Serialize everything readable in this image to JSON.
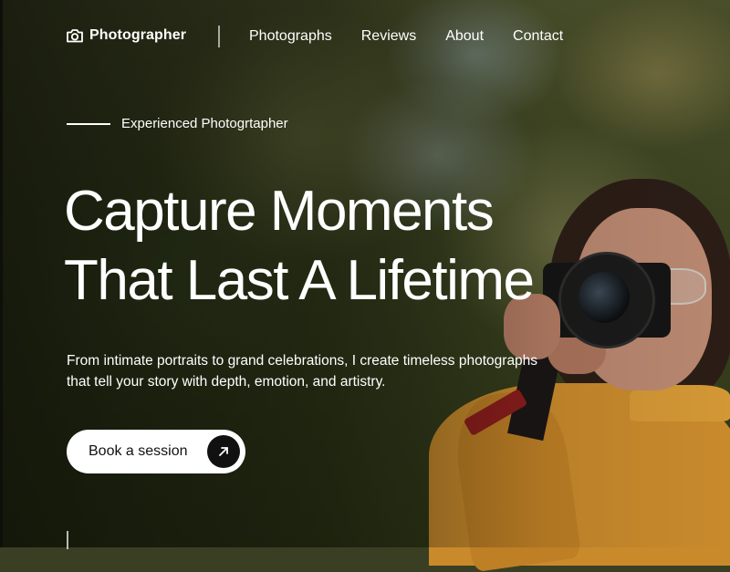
{
  "nav": {
    "brand": "Photographer",
    "brand_icon": "camera-icon",
    "links": [
      "Photographs",
      "Reviews",
      "About",
      "Contact"
    ]
  },
  "hero": {
    "eyebrow": "Experienced Photogrtapher",
    "headline": [
      "Capture Moments",
      "That Last A Lifetime"
    ],
    "lede": "From intimate portraits to grand celebrations, I create timeless photographs that tell your story with depth, emotion, and artistry.",
    "cta": {
      "label": "Book a session",
      "icon": "arrow-up-right-icon"
    }
  },
  "colors": {
    "text": "#ffffff",
    "cta_background": "#ffffff",
    "cta_icon_background": "#111111",
    "sweater": "#c98a2c"
  }
}
